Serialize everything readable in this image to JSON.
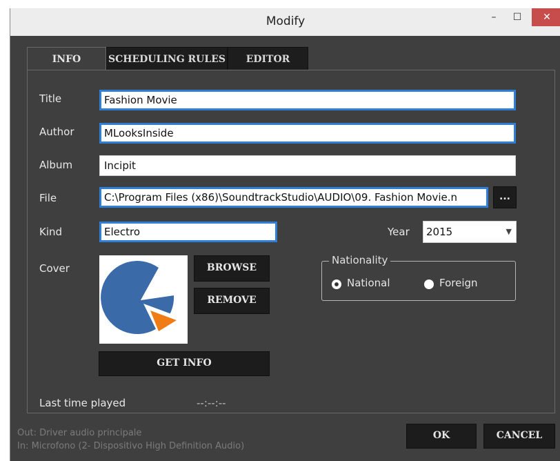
{
  "window": {
    "title": "Modify",
    "minimize_glyph": "–",
    "maximize_glyph": "☐",
    "close_glyph": "✕"
  },
  "tabs": [
    {
      "label": "INFO",
      "active": true
    },
    {
      "label": "SCHEDULING RULES",
      "active": false
    },
    {
      "label": "EDITOR",
      "active": false
    }
  ],
  "form": {
    "title": {
      "label": "Title",
      "value": "Fashion Movie"
    },
    "author": {
      "label": "Author",
      "value": "MLooksInside"
    },
    "album": {
      "label": "Album",
      "value": "Incipit"
    },
    "file": {
      "label": "File",
      "value": "C:\\Program Files (x86)\\SoundtrackStudio\\AUDIO\\09. Fashion Movie.n",
      "browse_label": "..."
    },
    "kind": {
      "label": "Kind",
      "value": "Electro"
    },
    "year": {
      "label": "Year",
      "value": "2015"
    },
    "cover": {
      "label": "Cover",
      "browse_label": "BROWSE",
      "remove_label": "REMOVE",
      "get_info_label": "GET INFO"
    },
    "nationality": {
      "legend": "Nationality",
      "options": [
        {
          "label": "National",
          "selected": true
        },
        {
          "label": "Foreign",
          "selected": false
        }
      ]
    },
    "last_played": {
      "label": "Last time played",
      "value": "--:--:--"
    }
  },
  "footer": {
    "out_text": "Out: Driver audio principale",
    "in_text": "In: Microfono (2- Dispositivo High Definition Audio)",
    "ok_label": "OK",
    "cancel_label": "CANCEL"
  },
  "colors": {
    "focus_border": "#2f7fd6",
    "cover_blue": "#3a6aa8",
    "cover_orange": "#ef7c14"
  },
  "icons": {
    "cover_image": "pie-chart-logo",
    "dropdown": "chevron-down-icon"
  }
}
